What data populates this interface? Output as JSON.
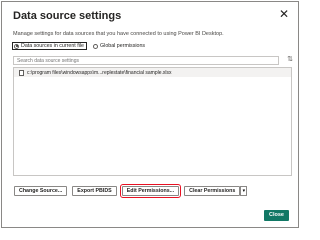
{
  "dialog": {
    "title": "Data source settings",
    "close_glyph": "✕",
    "description": "Manage settings for data sources that you have connected to using Power BI Desktop.",
    "scope": {
      "options": [
        {
          "label": "Data sources in current file",
          "selected": true
        },
        {
          "label": "Global permissions",
          "selected": false
        }
      ]
    },
    "search": {
      "placeholder": "Search data source settings",
      "value": ""
    },
    "sort_icon": "sort-icon",
    "sources": [
      {
        "label": "c:\\program files\\windowsapps\\m...replestate\\financial sample.xlsx",
        "icon": "file-icon"
      }
    ],
    "buttons": {
      "change_source": "Change Source...",
      "export_pbids": "Export PBIDS",
      "edit_permissions": "Edit Permissions...",
      "clear_permissions": "Clear Permissions",
      "clear_dropdown": "▾",
      "close": "Close"
    },
    "highlight_color": "#e81123",
    "accent_color": "#117865"
  }
}
